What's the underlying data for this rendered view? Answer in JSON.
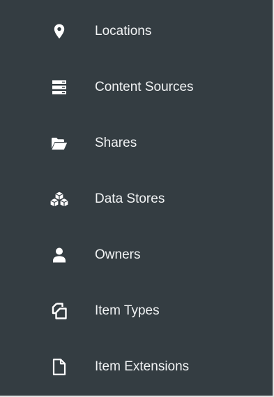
{
  "sidebar": {
    "items": [
      {
        "label": "Locations",
        "icon": "map-pin-icon"
      },
      {
        "label": "Content Sources",
        "icon": "server-stack-icon"
      },
      {
        "label": "Shares",
        "icon": "folder-open-icon"
      },
      {
        "label": "Data Stores",
        "icon": "cubes-icon"
      },
      {
        "label": "Owners",
        "icon": "user-icon"
      },
      {
        "label": "Item Types",
        "icon": "clone-icon"
      },
      {
        "label": "Item Extensions",
        "icon": "file-outline-icon"
      }
    ]
  },
  "colors": {
    "background": "#343d42",
    "text": "#f1f3f4",
    "icon": "#ffffff",
    "border": "#e4e4e4"
  }
}
